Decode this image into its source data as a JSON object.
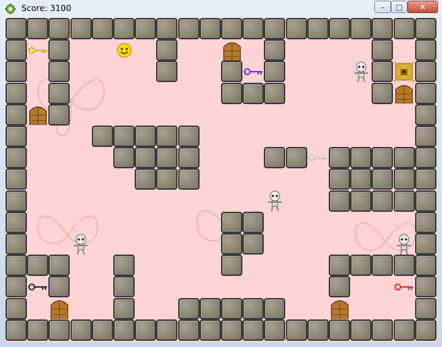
{
  "window": {
    "title": "Score: 3100",
    "buttons": {
      "minimize": "–",
      "maximize": "□",
      "close": "✕"
    }
  },
  "game": {
    "walls": [
      [
        0,
        0
      ],
      [
        1,
        0
      ],
      [
        2,
        0
      ],
      [
        3,
        0
      ],
      [
        4,
        0
      ],
      [
        5,
        0
      ],
      [
        6,
        0
      ],
      [
        7,
        0
      ],
      [
        8,
        0
      ],
      [
        9,
        0
      ],
      [
        10,
        0
      ],
      [
        11,
        0
      ],
      [
        12,
        0
      ],
      [
        13,
        0
      ],
      [
        14,
        0
      ],
      [
        15,
        0
      ],
      [
        16,
        0
      ],
      [
        17,
        0
      ],
      [
        18,
        0
      ],
      [
        19,
        0
      ],
      [
        0,
        1
      ],
      [
        2,
        1
      ],
      [
        7,
        1
      ],
      [
        12,
        1
      ],
      [
        17,
        1
      ],
      [
        19,
        1
      ],
      [
        0,
        2
      ],
      [
        2,
        2
      ],
      [
        7,
        2
      ],
      [
        10,
        2
      ],
      [
        12,
        2
      ],
      [
        17,
        2
      ],
      [
        19,
        2
      ],
      [
        0,
        3
      ],
      [
        2,
        3
      ],
      [
        10,
        3
      ],
      [
        11,
        3
      ],
      [
        12,
        3
      ],
      [
        17,
        3
      ],
      [
        19,
        3
      ],
      [
        0,
        4
      ],
      [
        2,
        4
      ],
      [
        19,
        4
      ],
      [
        0,
        5
      ],
      [
        4,
        5
      ],
      [
        5,
        5
      ],
      [
        6,
        5
      ],
      [
        7,
        5
      ],
      [
        8,
        5
      ],
      [
        19,
        5
      ],
      [
        0,
        6
      ],
      [
        5,
        6
      ],
      [
        6,
        6
      ],
      [
        7,
        6
      ],
      [
        8,
        6
      ],
      [
        12,
        6
      ],
      [
        13,
        6
      ],
      [
        15,
        6
      ],
      [
        16,
        6
      ],
      [
        17,
        6
      ],
      [
        18,
        6
      ],
      [
        19,
        6
      ],
      [
        0,
        7
      ],
      [
        6,
        7
      ],
      [
        7,
        7
      ],
      [
        8,
        7
      ],
      [
        15,
        7
      ],
      [
        16,
        7
      ],
      [
        17,
        7
      ],
      [
        18,
        7
      ],
      [
        19,
        7
      ],
      [
        0,
        8
      ],
      [
        15,
        8
      ],
      [
        16,
        8
      ],
      [
        17,
        8
      ],
      [
        18,
        8
      ],
      [
        19,
        8
      ],
      [
        0,
        9
      ],
      [
        10,
        9
      ],
      [
        11,
        9
      ],
      [
        19,
        9
      ],
      [
        0,
        10
      ],
      [
        10,
        10
      ],
      [
        11,
        10
      ],
      [
        19,
        10
      ],
      [
        0,
        11
      ],
      [
        1,
        11
      ],
      [
        2,
        11
      ],
      [
        5,
        11
      ],
      [
        10,
        11
      ],
      [
        15,
        11
      ],
      [
        16,
        11
      ],
      [
        17,
        11
      ],
      [
        18,
        11
      ],
      [
        19,
        11
      ],
      [
        0,
        12
      ],
      [
        2,
        12
      ],
      [
        5,
        12
      ],
      [
        15,
        12
      ],
      [
        19,
        12
      ],
      [
        0,
        13
      ],
      [
        5,
        13
      ],
      [
        8,
        13
      ],
      [
        9,
        13
      ],
      [
        10,
        13
      ],
      [
        11,
        13
      ],
      [
        12,
        13
      ],
      [
        19,
        13
      ],
      [
        0,
        14
      ],
      [
        1,
        14
      ],
      [
        2,
        14
      ],
      [
        3,
        14
      ],
      [
        4,
        14
      ],
      [
        5,
        14
      ],
      [
        6,
        14
      ],
      [
        7,
        14
      ],
      [
        8,
        14
      ],
      [
        9,
        14
      ],
      [
        10,
        14
      ],
      [
        11,
        14
      ],
      [
        12,
        14
      ],
      [
        13,
        14
      ],
      [
        14,
        14
      ],
      [
        15,
        14
      ],
      [
        16,
        14
      ],
      [
        17,
        14
      ],
      [
        18,
        14
      ],
      [
        19,
        14
      ]
    ],
    "doors": [
      [
        10,
        1
      ],
      [
        1,
        4
      ],
      [
        18,
        3
      ],
      [
        2,
        13
      ],
      [
        15,
        13
      ]
    ],
    "keys": [
      {
        "color": "#e0b000",
        "cell": [
          1,
          1
        ]
      },
      {
        "color": "#7a2bd8",
        "cell": [
          11,
          2
        ]
      },
      {
        "color": "#c7c7c7",
        "cell": [
          14,
          6
        ]
      },
      {
        "color": "#222a44",
        "cell": [
          1,
          12
        ]
      },
      {
        "color": "#d53030",
        "cell": [
          18,
          12
        ]
      }
    ],
    "skeletons": [
      [
        16,
        2
      ],
      [
        12,
        8
      ],
      [
        3,
        10
      ],
      [
        18,
        10
      ]
    ],
    "locked_door": [
      18,
      2
    ],
    "player": [
      5,
      1
    ]
  }
}
